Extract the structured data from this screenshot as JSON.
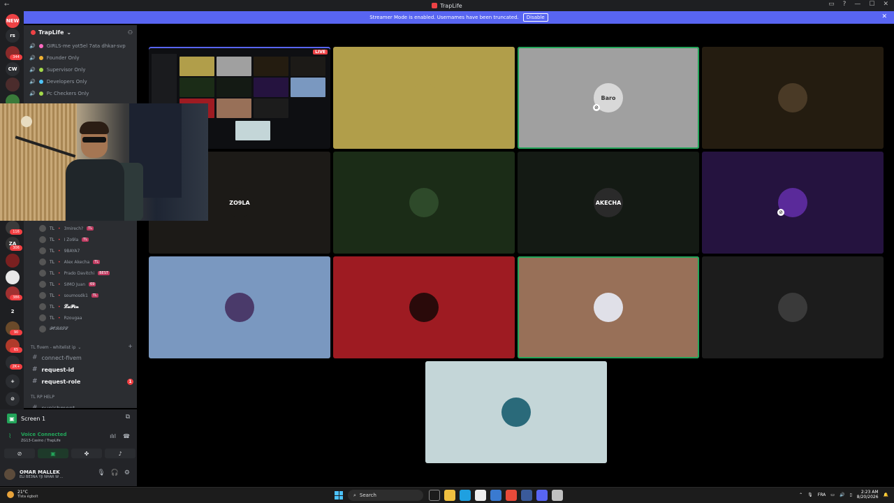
{
  "titlebar": {
    "title": "TrapLife",
    "back": "←",
    "controls": [
      "▭",
      "?",
      "—",
      "☐",
      "✕"
    ]
  },
  "banner": {
    "text": "Streamer Mode is enabled. Usernames have been truncated.",
    "disable_label": "Disable",
    "close": "✕"
  },
  "rail": {
    "servers": [
      {
        "label": "NEW",
        "color": "#ed4245",
        "badge": ""
      },
      {
        "label": "rs",
        "color": "#2b2d31",
        "badge": ""
      },
      {
        "label": "",
        "color": "#8a2a2a",
        "badge": "344"
      },
      {
        "label": "CW",
        "color": "#2b2d31",
        "badge": ""
      },
      {
        "label": "",
        "color": "#4b2c2c",
        "badge": ""
      },
      {
        "label": "",
        "color": "#3a7a3a",
        "badge": ""
      }
    ],
    "lower_servers": [
      {
        "label": "",
        "color": "#3a3a3a",
        "badge": "116"
      },
      {
        "label": "ZA",
        "color": "#333",
        "badge": "306"
      },
      {
        "label": "",
        "color": "#7a2020",
        "badge": ""
      },
      {
        "label": "",
        "color": "#e8e8e8",
        "badge": ""
      },
      {
        "label": "",
        "color": "#a03030",
        "badge": "386"
      },
      {
        "label": "2",
        "color": "#1e1f22",
        "badge": ""
      },
      {
        "label": "",
        "color": "#6a4a2a",
        "badge": "90"
      },
      {
        "label": "",
        "color": "#b03a2a",
        "badge": "65"
      },
      {
        "label": "",
        "color": "#2b2d31",
        "badge": "2K+"
      },
      {
        "label": "+",
        "color": "#2b2d31",
        "badge": ""
      },
      {
        "label": "⊘",
        "color": "#2b2d31",
        "badge": ""
      }
    ]
  },
  "sidebar": {
    "server_name": "TrapLife",
    "voice_channels": [
      {
        "name": "GIRLS-me yot5el 7ata dhkar-svp",
        "emoji_color": "#ff6ac1"
      },
      {
        "name": "Founder Only",
        "emoji_color": "#f0b232"
      },
      {
        "name": "Supervisor Only",
        "emoji_color": "#a3d94a"
      },
      {
        "name": "Developers Only",
        "emoji_color": "#4fc3f7"
      },
      {
        "name": "Pc Checkers Only",
        "emoji_color": "#a3d94a"
      }
    ],
    "voice_users": [
      {
        "prefix": "TL",
        "name": "3mirech?",
        "tag": "TL"
      },
      {
        "prefix": "TL",
        "name": "I Zo9la",
        "tag": "TL"
      },
      {
        "prefix": "TL",
        "name": "9BAYA7",
        "tag": ""
      },
      {
        "prefix": "TL",
        "name": "Alex Akecha",
        "tag": "TL"
      },
      {
        "prefix": "TL",
        "name": "Prado Davitchi",
        "tag": "BEST"
      },
      {
        "prefix": "TL",
        "name": "SIMO Juan",
        "tag": "69"
      },
      {
        "prefix": "TL",
        "name": "soumosdk1",
        "tag": "TL"
      },
      {
        "prefix": "TL",
        "name": "𝓛𝓪𝓟𝓲𝓷",
        "tag": ""
      },
      {
        "prefix": "TL",
        "name": "Rzougaa",
        "tag": ""
      },
      {
        "prefix": "",
        "name": "𝓕𝓞𝓡𝓔𝓢𝓣",
        "tag": ""
      }
    ],
    "category_1": "TL fivem - whitelist ip",
    "text_channels": [
      {
        "name": "connect-fivem",
        "bold": false,
        "badge": ""
      },
      {
        "name": "request-id",
        "bold": true,
        "badge": ""
      },
      {
        "name": "request-role",
        "bold": true,
        "badge": "1"
      }
    ],
    "category_2": "TL RP HELP",
    "cut_channel": "punishment"
  },
  "grid": {
    "tiles": [
      {
        "bg": "#b19e4a",
        "avatar_color": "#b19e4a",
        "avatar_text": "",
        "speaking": false,
        "muted": false
      },
      {
        "bg": "#a0a0a0",
        "avatar_color": "#d8d8d8",
        "avatar_text": "Baro",
        "speaking": true,
        "muted": true
      },
      {
        "bg": "#241c10",
        "avatar_color": "#4a3a26",
        "avatar_text": "",
        "speaking": false,
        "muted": false
      },
      {
        "bg": "#1c1a17",
        "avatar_color": "#1c1a17",
        "avatar_text": "ZO9LA",
        "speaking": false,
        "muted": false
      },
      {
        "bg": "#1b2c17",
        "avatar_color": "#2e4a2a",
        "avatar_text": "",
        "speaking": false,
        "muted": false
      },
      {
        "bg": "#141a14",
        "avatar_color": "#2a2a2a",
        "avatar_text": "AKECHA",
        "speaking": false,
        "muted": false
      },
      {
        "bg": "#25133f",
        "avatar_color": "#5a2a9a",
        "avatar_text": "",
        "speaking": false,
        "muted": true
      },
      {
        "bg": "#7a98c0",
        "avatar_color": "#4a3a6a",
        "avatar_text": "",
        "speaking": false,
        "muted": false
      },
      {
        "bg": "#9e1b22",
        "avatar_color": "#2a0a0a",
        "avatar_text": "",
        "speaking": false,
        "muted": false
      },
      {
        "bg": "#987058",
        "avatar_color": "#e0e0e8",
        "avatar_text": "",
        "speaking": true,
        "muted": false
      },
      {
        "bg": "#1c1c1c",
        "avatar_color": "#3a3a3a",
        "avatar_text": "",
        "speaking": false,
        "muted": false
      },
      {
        "bg": "#c4d6d8",
        "avatar_color": "#2a6a7a",
        "avatar_text": "",
        "speaking": false,
        "muted": false
      }
    ],
    "share_live": "LIVE"
  },
  "panel": {
    "screen_label": "Screen 1",
    "voice_connected": "Voice Connected",
    "voice_location": "ZG13-Casino / TrapLife",
    "username": "OMAR MALLEK",
    "status": "ELI BE3NA YJI NHAR W ..."
  },
  "taskbar": {
    "temp": "21°C",
    "condition": "Tîsta égbolt",
    "search_placeholder": "Search",
    "lang": "FRA",
    "time": "2:23 AM",
    "date": "8/20/2026",
    "apps": [
      "#888",
      "#f0c040",
      "#1fa0e0",
      "#eee",
      "#3a7ad0",
      "#e84a3a",
      "#3a5a9a",
      "#5865f2",
      "#c0c0c0"
    ]
  }
}
